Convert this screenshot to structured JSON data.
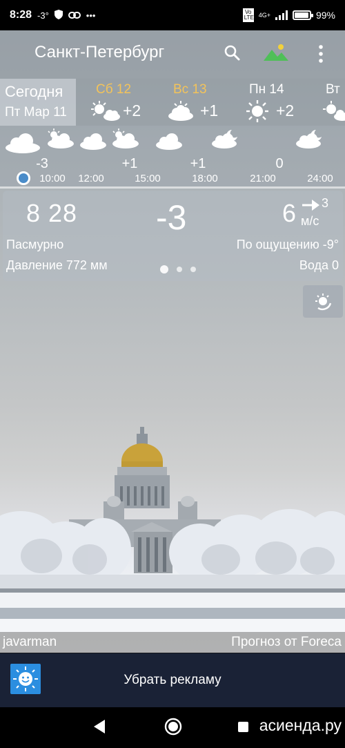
{
  "status_bar": {
    "time": "8:28",
    "temp": "-3°",
    "battery": "99%",
    "net": "4G+",
    "volte": "Vo LTE"
  },
  "header": {
    "city": "Санкт-Петербург"
  },
  "today": {
    "title": "Сегодня",
    "date": "Пт Мар 11"
  },
  "days": [
    {
      "name": "Сб 12",
      "temp": "+2",
      "color": "#f3c35a",
      "icon": "sun-cloud-icon"
    },
    {
      "name": "Вс 13",
      "temp": "+1",
      "color": "#f3c35a",
      "icon": "cloud-sun-icon"
    },
    {
      "name": "Пн 14",
      "temp": "+2",
      "color": "#ffffff",
      "icon": "sun-icon"
    },
    {
      "name": "Вт",
      "temp": "",
      "color": "#ffffff",
      "icon": "sun-cloud-icon"
    }
  ],
  "hourly": {
    "temps": [
      "-3",
      "+1",
      "+1",
      "0"
    ],
    "times": [
      "10:00",
      "12:00",
      "15:00",
      "18:00",
      "21:00",
      "24:00"
    ]
  },
  "current": {
    "clock": "8 28",
    "temp": "-3",
    "wind_speed": "6",
    "wind_dir": "3",
    "wind_unit": "м/с",
    "condition": "Пасмурно",
    "feels_like": "По ощущению -9°",
    "pressure": "Давление 772 мм",
    "water": "Вода 0"
  },
  "credits": {
    "photo_author": "javarman",
    "forecast_source": "Прогноз от Foreca"
  },
  "ad": {
    "label": "Убрать рекламу"
  },
  "watermark": "асиенда.ру"
}
